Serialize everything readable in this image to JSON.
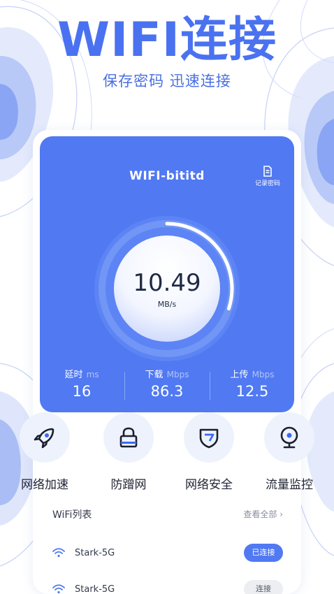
{
  "header": {
    "title": "WIFI连接",
    "subtitle": "保存密码 迅速连接"
  },
  "speed_card": {
    "ssid": "WIFI-bititd",
    "record_label": "记录密码",
    "speed_value": "10.49",
    "speed_unit": "MB/s",
    "gauge_progress": 0.3,
    "stats": [
      {
        "label": "延时",
        "unit": "ms",
        "value": "16"
      },
      {
        "label": "下载",
        "unit": "Mbps",
        "value": "86.3"
      },
      {
        "label": "上传",
        "unit": "Mbps",
        "value": "12.5"
      }
    ]
  },
  "tools": [
    {
      "label": "网络加速",
      "icon": "rocket-icon"
    },
    {
      "label": "防蹭网",
      "icon": "lock-icon"
    },
    {
      "label": "网络安全",
      "icon": "shield-icon"
    },
    {
      "label": "流量监控",
      "icon": "webcam-icon"
    }
  ],
  "wifi_list": {
    "title": "WiFi列表",
    "see_all": "查看全部 ›",
    "items": [
      {
        "name": "Stark-5G",
        "action": "已连接",
        "status": "connected"
      },
      {
        "name": "Stark-5G",
        "action": "连接",
        "status": "available"
      }
    ]
  },
  "colors": {
    "accent": "#5079f2",
    "title": "#4a72f0",
    "tool_bg": "#eef2fd",
    "text_dark": "#1f2433"
  }
}
